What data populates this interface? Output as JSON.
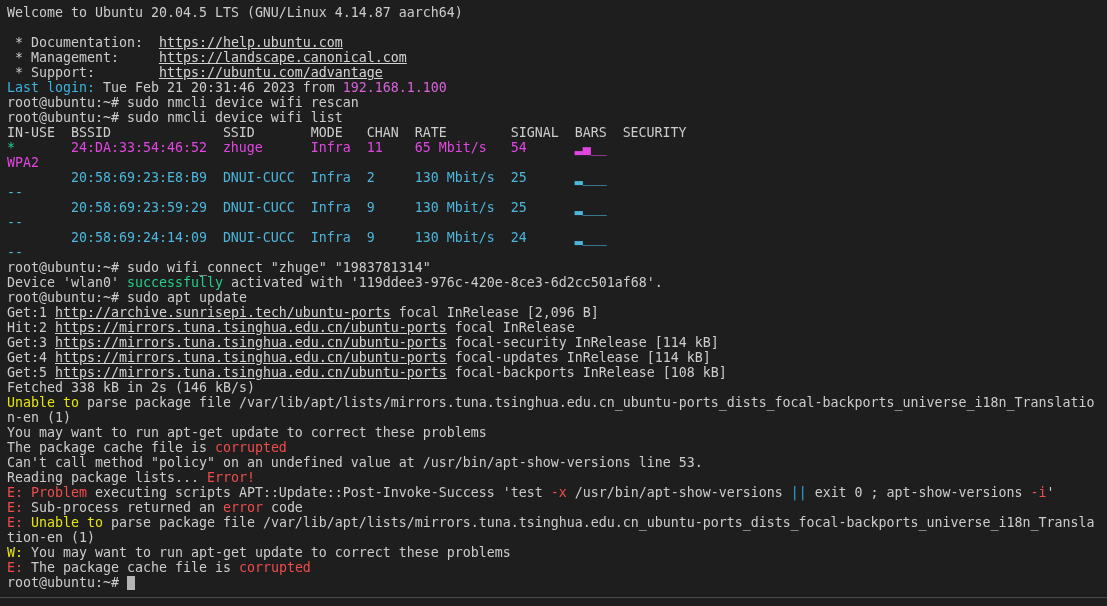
{
  "terminal": {
    "welcome": "Welcome to Ubuntu 20.04.5 LTS (GNU/Linux 4.14.87 aarch64)",
    "motd": [
      {
        "label": "* Documentation:",
        "url": "https://help.ubuntu.com"
      },
      {
        "label": "* Management:",
        "url": "https://landscape.canonical.com"
      },
      {
        "label": "* Support:",
        "url": "https://ubuntu.com/advantage"
      }
    ],
    "transcript": [
      {
        "kind": "line",
        "segments": [
          {
            "kind": "label",
            "text": "Last login:"
          },
          {
            "kind": "plain",
            "text": " Tue Feb 21 20:31:46 2023 from "
          },
          {
            "kind": "host",
            "text": "192.168.1.100"
          }
        ]
      },
      {
        "kind": "command",
        "prompt": "root@ubuntu:~#",
        "command": "sudo nmcli device wifi rescan",
        "cursor": false
      },
      {
        "kind": "command",
        "prompt": "root@ubuntu:~#",
        "command": "sudo nmcli device wifi list",
        "cursor": false
      },
      {
        "kind": "table",
        "columns": [
          "IN-USE",
          "BSSID",
          "SSID",
          "MODE",
          "CHAN",
          "RATE",
          "SIGNAL",
          "BARS",
          "SECURITY"
        ],
        "rows": [
          {
            "selected": true,
            "in_use": "*",
            "bssid": "24:DA:33:54:46:52",
            "ssid": "zhuge",
            "mode": "Infra",
            "chan": "11",
            "rate": "65 Mbit/s",
            "signal": "54",
            "bars": "▂▄__",
            "security": "WPA2"
          },
          {
            "selected": false,
            "bssid": "20:58:69:23:E8:B9",
            "ssid": "DNUI-CUCC",
            "mode": "Infra",
            "chan": "2",
            "rate": "130 Mbit/s",
            "signal": "25",
            "bars": "▂___",
            "security": "--"
          },
          {
            "selected": false,
            "bssid": "20:58:69:23:59:29",
            "ssid": "DNUI-CUCC",
            "mode": "Infra",
            "chan": "9",
            "rate": "130 Mbit/s",
            "signal": "25",
            "bars": "▂___",
            "security": "--"
          },
          {
            "selected": false,
            "bssid": "20:58:69:24:14:09",
            "ssid": "DNUI-CUCC",
            "mode": "Infra",
            "chan": "9",
            "rate": "130 Mbit/s",
            "signal": "24",
            "bars": "▂___",
            "security": "--"
          }
        ]
      },
      {
        "kind": "command",
        "prompt": "root@ubuntu:~#",
        "command": "sudo wifi_connect \"zhuge\" \"1983781314\"",
        "cursor": false
      },
      {
        "kind": "line",
        "segments": [
          {
            "kind": "plain",
            "text": "Device 'wlan0' "
          },
          {
            "kind": "ok",
            "text": "successfully"
          },
          {
            "kind": "plain",
            "text": " activated with '119ddee3-976c-420e-8ce3-6d2cc501af68'."
          }
        ]
      },
      {
        "kind": "command",
        "prompt": "root@ubuntu:~#",
        "command": "sudo apt update",
        "cursor": false
      },
      {
        "kind": "line",
        "segments": [
          {
            "kind": "plain",
            "text": "Get:1"
          },
          {
            "kind": "link",
            "text": "http://archive.sunrisepi.tech/ubuntu-ports"
          },
          {
            "kind": "plain",
            "text": "focal InRelease [2,096 B]"
          }
        ]
      },
      {
        "kind": "line",
        "segments": [
          {
            "kind": "plain",
            "text": "Hit:2"
          },
          {
            "kind": "link",
            "text": "https://mirrors.tuna.tsinghua.edu.cn/ubuntu-ports"
          },
          {
            "kind": "plain",
            "text": "focal InRelease"
          }
        ]
      },
      {
        "kind": "line",
        "segments": [
          {
            "kind": "plain",
            "text": "Get:3"
          },
          {
            "kind": "link",
            "text": "https://mirrors.tuna.tsinghua.edu.cn/ubuntu-ports"
          },
          {
            "kind": "plain",
            "text": "focal-security InRelease [114 kB]"
          }
        ]
      },
      {
        "kind": "line",
        "segments": [
          {
            "kind": "plain",
            "text": "Get:4"
          },
          {
            "kind": "link",
            "text": "https://mirrors.tuna.tsinghua.edu.cn/ubuntu-ports"
          },
          {
            "kind": "plain",
            "text": "focal-updates InRelease [114 kB]"
          }
        ]
      },
      {
        "kind": "line",
        "segments": [
          {
            "kind": "plain",
            "text": "Get:5"
          },
          {
            "kind": "link",
            "text": "https://mirrors.tuna.tsinghua.edu.cn/ubuntu-ports"
          },
          {
            "kind": "plain",
            "text": "focal-backports InRelease [108 kB]"
          }
        ]
      },
      {
        "kind": "line",
        "segments": [
          {
            "kind": "plain",
            "text": "Fetched 338 kB in 2s (146 kB/s)"
          }
        ]
      },
      {
        "kind": "line",
        "segments": [
          {
            "kind": "warn",
            "text": "Unable to"
          },
          {
            "kind": "plain",
            "text": " parse package file /var/lib/apt/lists/mirrors.tuna.tsinghua.edu.cn_ubuntu-ports_dists_focal-backports_universe_i18n_Translation-en (1)"
          }
        ]
      },
      {
        "kind": "line",
        "segments": [
          {
            "kind": "plain",
            "text": "You may want to run apt-get update to correct these problems"
          }
        ]
      },
      {
        "kind": "line",
        "segments": [
          {
            "kind": "plain",
            "text": "The package cache file is "
          },
          {
            "kind": "err",
            "text": "corrupted"
          }
        ]
      },
      {
        "kind": "line",
        "segments": [
          {
            "kind": "plain",
            "text": "Can't call method \"policy\" on an undefined value at /usr/bin/apt-show-versions line 53."
          }
        ]
      },
      {
        "kind": "line",
        "segments": [
          {
            "kind": "plain",
            "text": "Reading package lists... "
          },
          {
            "kind": "err",
            "text": "Error!"
          }
        ]
      },
      {
        "kind": "line",
        "segments": [
          {
            "kind": "err",
            "text": "E: Problem"
          },
          {
            "kind": "plain",
            "text": " executing scripts APT::Update::Post-Invoke-Success 'test "
          },
          {
            "kind": "err",
            "text": "-x"
          },
          {
            "kind": "plain",
            "text": " /usr/bin/apt-show-versions "
          },
          {
            "kind": "op",
            "text": "||"
          },
          {
            "kind": "plain",
            "text": " exit 0 ; apt-show-versions "
          },
          {
            "kind": "err",
            "text": "-i"
          },
          {
            "kind": "plain",
            "text": "'"
          }
        ]
      },
      {
        "kind": "line",
        "segments": [
          {
            "kind": "err",
            "text": "E:"
          },
          {
            "kind": "plain",
            "text": " Sub-process returned an "
          },
          {
            "kind": "err",
            "text": "error"
          },
          {
            "kind": "plain",
            "text": " code"
          }
        ]
      },
      {
        "kind": "line",
        "segments": [
          {
            "kind": "err",
            "text": "E: "
          },
          {
            "kind": "warn",
            "text": "Unable to"
          },
          {
            "kind": "plain",
            "text": " parse package file /var/lib/apt/lists/mirrors.tuna.tsinghua.edu.cn_ubuntu-ports_dists_focal-backports_universe_i18n_Translation-en (1)"
          }
        ]
      },
      {
        "kind": "line",
        "segments": [
          {
            "kind": "warn",
            "text": "W:"
          },
          {
            "kind": "plain",
            "text": " You may want to run apt-get update to correct these problems"
          }
        ]
      },
      {
        "kind": "line",
        "segments": [
          {
            "kind": "err",
            "text": "E:"
          },
          {
            "kind": "plain",
            "text": " The package cache file is "
          },
          {
            "kind": "err",
            "text": "corrupted"
          }
        ]
      },
      {
        "kind": "command",
        "prompt": "root@ubuntu:~#",
        "cursor": true
      }
    ]
  }
}
